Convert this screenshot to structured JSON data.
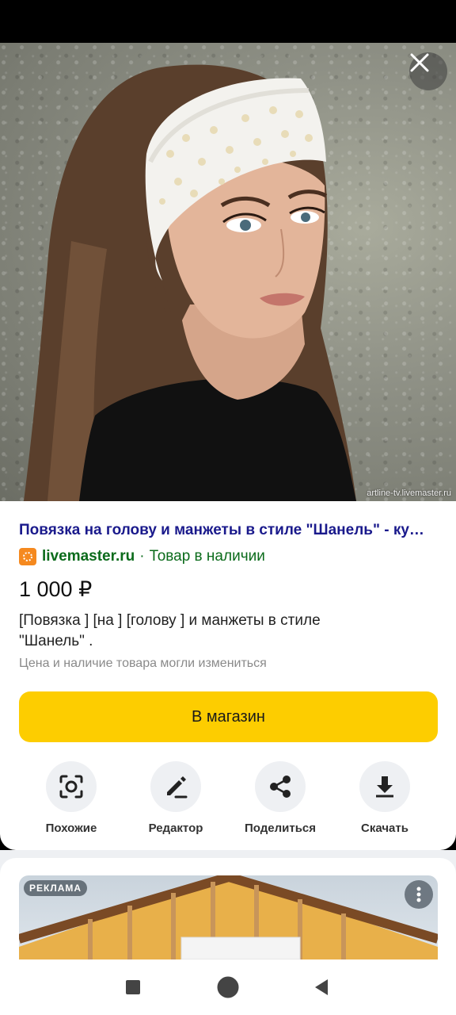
{
  "photo": {
    "watermark": "artline-tv.livemaster.ru",
    "close_icon": "close-icon"
  },
  "result": {
    "title": "Повязка на голову и манжеты в стиле \"Шанель\" - ку…",
    "domain": "livemaster.ru",
    "separator": "·",
    "availability": "Товар в наличии",
    "price": "1 000 ₽",
    "description_line1": " [Повязка ]  [на ]  [голову ] и манжеты в стиле",
    "description_line2": "\"Шанель\" .",
    "notice": "Цена и наличие товара могли измениться",
    "shop_button": "В магазин"
  },
  "actions": [
    {
      "label": "Похожие",
      "icon": "similar-scan-icon"
    },
    {
      "label": "Редактор",
      "icon": "pencil-icon"
    },
    {
      "label": "Поделиться",
      "icon": "share-icon"
    },
    {
      "label": "Скачать",
      "icon": "download-icon"
    }
  ],
  "ad": {
    "badge": "РЕКЛАМА",
    "menu_icon": "more-vertical-icon"
  },
  "colors": {
    "title": "#1a1a8c",
    "domain": "#0b6b1b",
    "shop_button": "#fdcd00"
  }
}
